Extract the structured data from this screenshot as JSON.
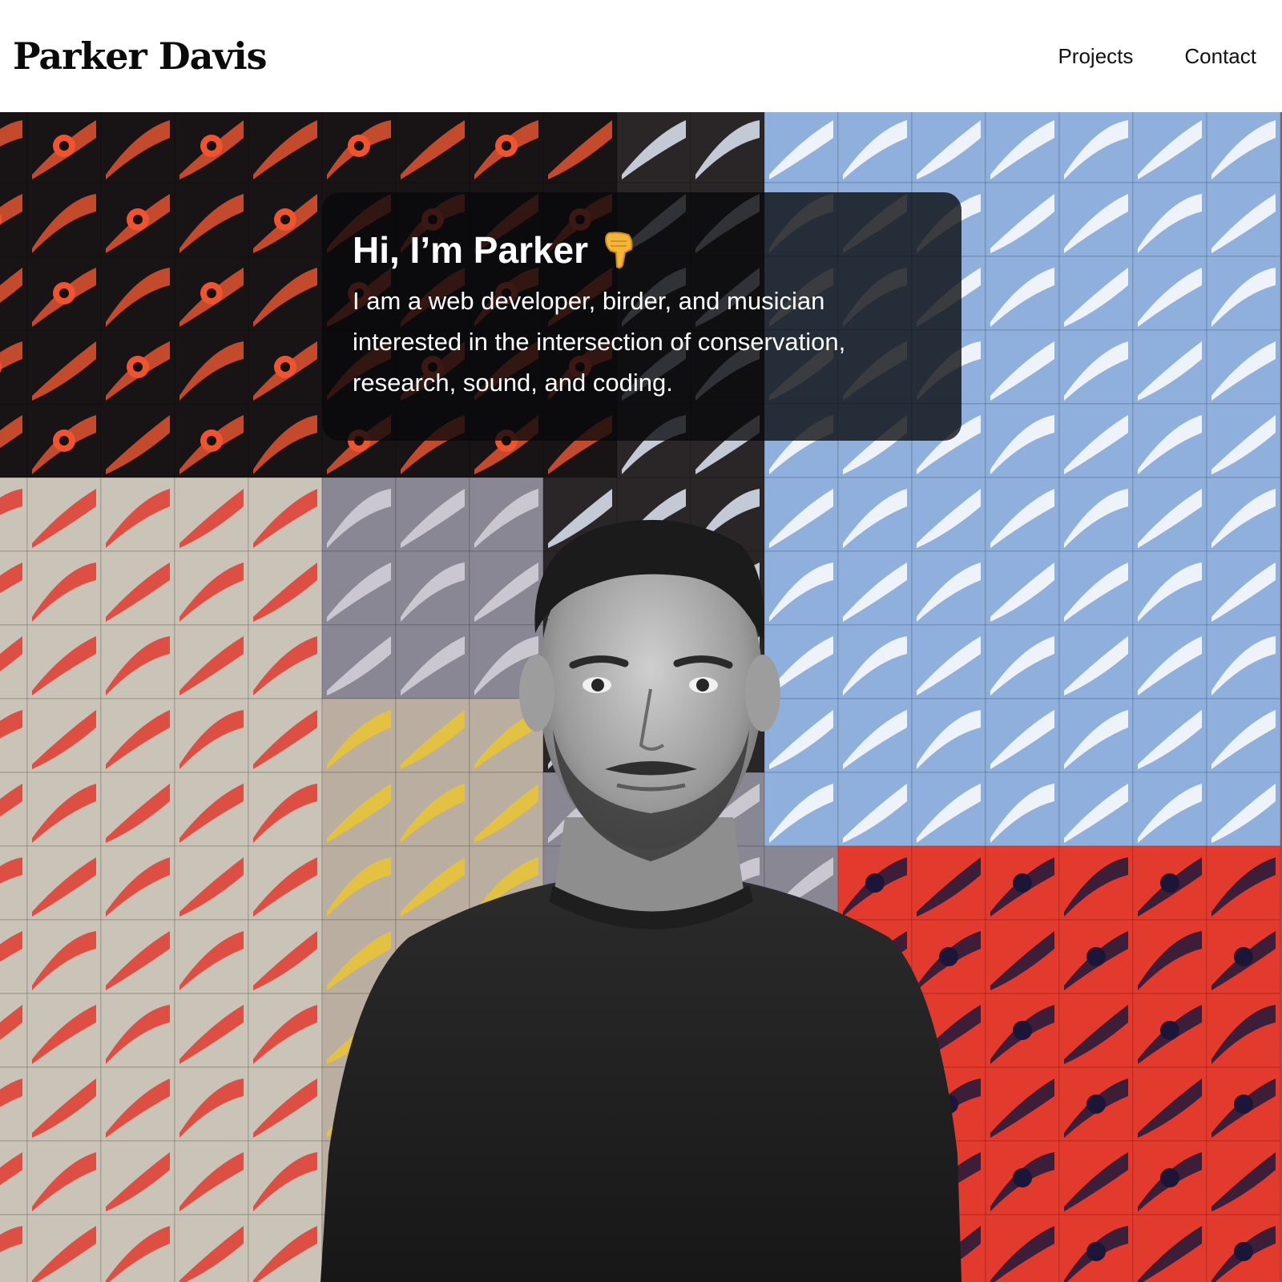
{
  "header": {
    "brand": "Parker Davis",
    "nav": [
      {
        "label": "Projects"
      },
      {
        "label": "Contact"
      }
    ]
  },
  "hero": {
    "title": "Hi, I’m Parker",
    "title_icon": "pointing-down-hand-icon",
    "intro": "I am a web developer, birder, and musician interested in the intersection of conservation, research, sound, and coding.",
    "background": "bird-feather-mosaic",
    "portrait": "grayscale-portrait-of-parker"
  },
  "colors": {
    "card_background": "#0a0a0c",
    "text_light": "#ffffff",
    "text_dark": "#111111",
    "mosaic_red": "#e23b2e",
    "mosaic_blue": "#8fb0dc",
    "mosaic_yellow": "#e9c52f",
    "mosaic_black": "#181416"
  }
}
